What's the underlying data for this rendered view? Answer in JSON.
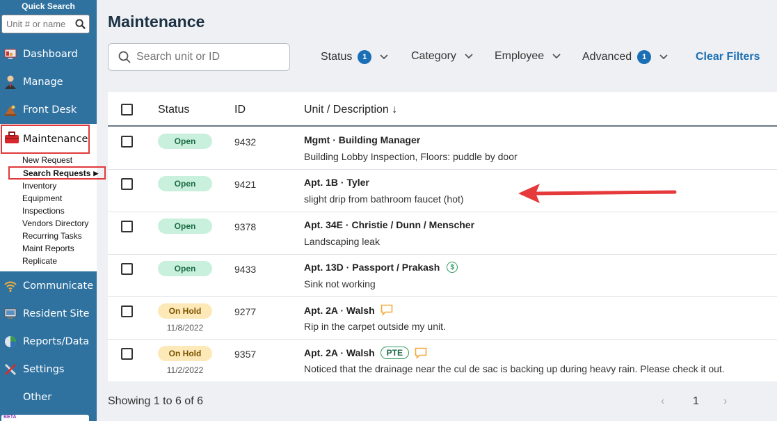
{
  "sidebar": {
    "quick_search_title": "Quick Search",
    "quick_search_placeholder": "Unit # or name",
    "nav": [
      {
        "label": "Dashboard",
        "icon": "dashboard-icon"
      },
      {
        "label": "Manage",
        "icon": "person-icon"
      },
      {
        "label": "Front Desk",
        "icon": "bell-icon"
      },
      {
        "label": "Maintenance",
        "icon": "toolbox-icon"
      },
      {
        "label": "Communicate",
        "icon": "wifi-icon"
      },
      {
        "label": "Resident Site",
        "icon": "monitor-icon"
      },
      {
        "label": "Reports/Data",
        "icon": "pie-chart-icon"
      },
      {
        "label": "Settings",
        "icon": "tools-icon"
      },
      {
        "label": "Other",
        "icon": ""
      }
    ],
    "maintenance_sub": [
      "New Request",
      "Search Requests",
      "Inventory",
      "Equipment",
      "Inspections",
      "Vendors Directory",
      "Recurring Tasks",
      "Maint Reports",
      "Replicate"
    ],
    "beta_label": "BETA"
  },
  "main": {
    "title": "Maintenance",
    "search_placeholder": "Search unit or ID",
    "filters": [
      {
        "label": "Status",
        "count": "1"
      },
      {
        "label": "Category",
        "count": ""
      },
      {
        "label": "Employee",
        "count": ""
      },
      {
        "label": "Advanced",
        "count": "1"
      }
    ],
    "clear_filters": "Clear Filters"
  },
  "table": {
    "headers": {
      "status": "Status",
      "id": "ID",
      "unit_description": "Unit / Description"
    },
    "rows": [
      {
        "status": "Open",
        "date": "",
        "id": "9432",
        "unit": "Mgmt · Building Manager",
        "desc": "Building Lobby Inspection, Floors: puddle by door",
        "tag": "",
        "dollar": false,
        "comment": false
      },
      {
        "status": "Open",
        "date": "",
        "id": "9421",
        "unit": "Apt. 1B · Tyler",
        "desc": "slight drip from bathroom faucet (hot)",
        "tag": "",
        "dollar": false,
        "comment": false
      },
      {
        "status": "Open",
        "date": "",
        "id": "9378",
        "unit": "Apt. 34E · Christie / Dunn / Menscher",
        "desc": "Landscaping leak",
        "tag": "",
        "dollar": false,
        "comment": false
      },
      {
        "status": "Open",
        "date": "",
        "id": "9433",
        "unit": "Apt. 13D · Passport / Prakash",
        "desc": "Sink not working",
        "tag": "",
        "dollar": true,
        "comment": false
      },
      {
        "status": "On Hold",
        "date": "11/8/2022",
        "id": "9277",
        "unit": "Apt. 2A · Walsh",
        "desc": "Rip in the carpet outside my unit.",
        "tag": "",
        "dollar": false,
        "comment": true
      },
      {
        "status": "On Hold",
        "date": "11/2/2022",
        "id": "9357",
        "unit": "Apt. 2A · Walsh",
        "desc": "Noticed that the drainage near the cul de sac is backing up during heavy rain. Please check it out.",
        "tag": "PTE",
        "dollar": false,
        "comment": true
      }
    ]
  },
  "footer": {
    "showing": "Showing 1 to 6 of 6",
    "page": "1"
  },
  "colors": {
    "sidebar": "#2f72a0",
    "accent": "#1a6fb5",
    "highlight": "#e0393b"
  }
}
